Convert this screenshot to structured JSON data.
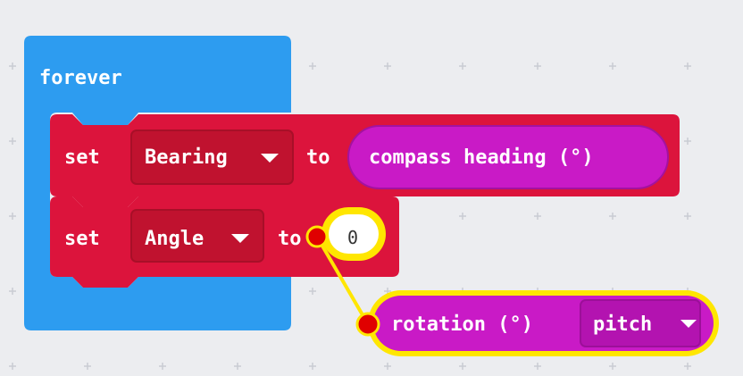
{
  "workspace": {
    "colors": {
      "background": "#ecedf0",
      "grid": "#c9ccd3",
      "loops_block": "#2d9cf0",
      "variable_block": "#dc143c",
      "input_block": "#c91ac6",
      "highlight": "#ffe600",
      "connector_dot": "#e00000"
    }
  },
  "blocks": {
    "forever": {
      "label": "forever",
      "icon": "loop-event-block"
    },
    "set_bearing": {
      "set_label": "set",
      "variable": "Bearing",
      "dropdown_icon": "triangle-down-icon",
      "to_label": "to",
      "value_block": "compass heading (°)"
    },
    "set_angle": {
      "set_label": "set",
      "variable": "Angle",
      "dropdown_icon": "triangle-down-icon",
      "to_label": "to",
      "value": "0"
    },
    "rotation": {
      "label": "rotation (°)",
      "option": "pitch",
      "dropdown_icon": "triangle-down-icon"
    }
  }
}
